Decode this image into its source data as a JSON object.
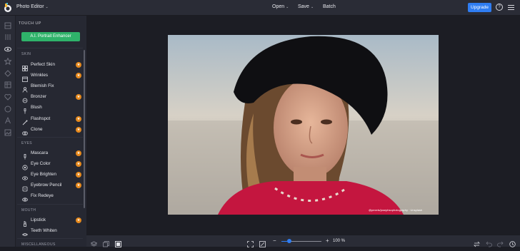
{
  "topbar": {
    "app_name": "Photo Editor",
    "menu": [
      "Open",
      "Save",
      "Batch"
    ],
    "upgrade_label": "Upgrade",
    "help_glyph": "?"
  },
  "panel": {
    "title": "TOUCH UP",
    "ai_button": "A.I. Portrait Enhancer",
    "sections": {
      "skin": "SKIN",
      "eyes": "EYES",
      "mouth": "MOUTH",
      "misc": "MISCELLANEOUS"
    },
    "skin_tools": [
      {
        "label": "Perfect Skin",
        "icon": "grid-icon",
        "premium": true
      },
      {
        "label": "Wrinkles",
        "icon": "calendar-icon",
        "premium": true
      },
      {
        "label": "Blemish Fix",
        "icon": "people-icon",
        "premium": false
      },
      {
        "label": "Bronzer",
        "icon": "bronzer-icon",
        "premium": true
      },
      {
        "label": "Blush",
        "icon": "brush-icon",
        "premium": false
      },
      {
        "label": "Flashspot",
        "icon": "wand-icon",
        "premium": true
      },
      {
        "label": "Clone",
        "icon": "clone-icon",
        "premium": true
      }
    ],
    "eye_tools": [
      {
        "label": "Mascara",
        "icon": "mascara-icon",
        "premium": true
      },
      {
        "label": "Eye Color",
        "icon": "eye-color-icon",
        "premium": true
      },
      {
        "label": "Eye Brighten",
        "icon": "eye-brighten-icon",
        "premium": true
      },
      {
        "label": "Eyebrow Pencil",
        "icon": "pencil-icon",
        "premium": true
      },
      {
        "label": "Fix Redeye",
        "icon": "redeye-icon",
        "premium": false
      }
    ],
    "mouth_tools": [
      {
        "label": "Lipstick",
        "icon": "lipstick-icon",
        "premium": true
      },
      {
        "label": "Teeth Whiten",
        "icon": "teeth-icon",
        "premium": false
      }
    ]
  },
  "canvas": {
    "watermark": "@pexels/josephsophotography · Unsplash"
  },
  "bottombar": {
    "zoom_label": "100 %",
    "zoom_level": 0.2
  },
  "colors": {
    "accent_blue": "#2f7df2",
    "ai_green": "#2fb36a",
    "premium_orange": "#e78a1d"
  }
}
